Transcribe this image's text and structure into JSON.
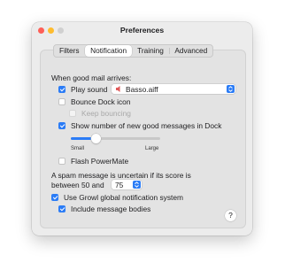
{
  "window": {
    "title": "Preferences"
  },
  "tabs": [
    {
      "label": "Filters",
      "selected": false
    },
    {
      "label": "Notification",
      "selected": true
    },
    {
      "label": "Training",
      "selected": false
    },
    {
      "label": "Advanced",
      "selected": false
    }
  ],
  "notification": {
    "section_label": "When good mail arrives:",
    "play_sound": {
      "label": "Play sound",
      "checked": true
    },
    "sound_select": {
      "value": "Basso.aiff",
      "icon": "speaker-icon"
    },
    "bounce_dock_icon": {
      "label": "Bounce Dock icon",
      "checked": false
    },
    "keep_bouncing": {
      "label": "Keep bouncing",
      "checked": false,
      "enabled": false
    },
    "show_count": {
      "label": "Show number of new good messages in Dock",
      "checked": true
    },
    "size_slider": {
      "value_fraction": 0.28,
      "min_label": "Small",
      "max_label": "Large"
    },
    "flash_powermate": {
      "label": "Flash PowerMate",
      "checked": false
    },
    "spam_text_line1": "A spam message is uncertain if its score is",
    "spam_text_line2": "between 50 and",
    "spam_threshold": {
      "value": "75"
    },
    "use_growl": {
      "label": "Use Growl global notification system",
      "checked": true
    },
    "include_bodies": {
      "label": "Include message bodies",
      "checked": true
    },
    "help_label": "?"
  },
  "colors": {
    "accent": "#2b7cf6",
    "close": "#fe5f57",
    "minimize": "#febc2e"
  }
}
